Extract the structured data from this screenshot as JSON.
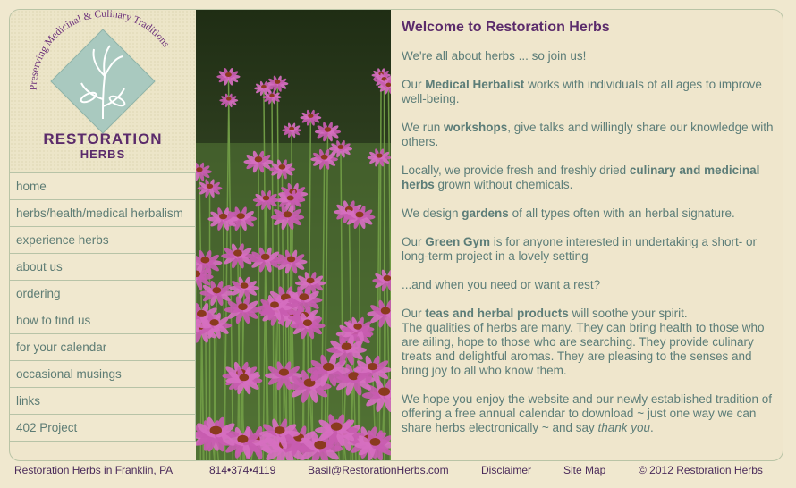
{
  "logo": {
    "arc_text": "Preserving Medicinal & Culinary Traditions",
    "name_line1": "RESTORATION",
    "name_line2": "HERBS"
  },
  "nav": {
    "items": [
      {
        "label": "home"
      },
      {
        "label": "herbs/health/medical herbalism"
      },
      {
        "label": "experience herbs"
      },
      {
        "label": "about us"
      },
      {
        "label": "ordering"
      },
      {
        "label": "how to find us"
      },
      {
        "label": "for your calendar"
      },
      {
        "label": "occasional musings"
      },
      {
        "label": "links"
      },
      {
        "label": "402 Project"
      }
    ]
  },
  "content": {
    "title": "Welcome to Restoration Herbs",
    "p1": "We're all about herbs ... so join us!",
    "p2_pre": "Our ",
    "p2_bold": "Medical Herbalist",
    "p2_post": " works with individuals of all ages to improve well-being.",
    "p3_pre": "We run ",
    "p3_bold": "workshops",
    "p3_post": ", give talks and willingly share our knowledge with others.",
    "p4_pre": "Locally, we provide fresh and freshly dried ",
    "p4_bold": "culinary and medicinal herbs",
    "p4_post": " grown without chemicals.",
    "p5_pre": "We design ",
    "p5_bold": "gardens",
    "p5_post": " of all types often with an herbal signature.",
    "p6_pre": "Our ",
    "p6_bold": "Green Gym",
    "p6_post": " is for anyone interested in undertaking a short- or long-term project in a lovely setting",
    "p7": "...and when you need or want a rest?",
    "p8_pre": "Our ",
    "p8_bold": "teas and herbal products",
    "p8_post": " will soothe your spirit.",
    "p8_rest": "The qualities of herbs are many. They can bring health to those who are ailing, hope to those who are searching. They provide culinary treats and delightful aromas. They are pleasing to the senses and bring joy to all who know them.",
    "p9_pre": "We hope you enjoy the website and our newly established tradition of offering a free annual calendar to download ~ just one way we can share herbs electronically ~ and say ",
    "p9_italic": "thank you",
    "p9_post": "."
  },
  "footer": {
    "location": "Restoration Herbs in Franklin, PA",
    "phone": "814•374•4119",
    "email": "Basil@RestorationHerbs.com",
    "disclaimer": "Disclaimer",
    "sitemap": "Site Map",
    "copyright": "© 2012 Restoration Herbs"
  },
  "colors": {
    "background": "#f0e8cf",
    "title_purple": "#5b2b6b",
    "text_teal": "#5c7d78",
    "nav_border": "#b7c3a7",
    "logo_diamond": "#a9c9bf"
  }
}
